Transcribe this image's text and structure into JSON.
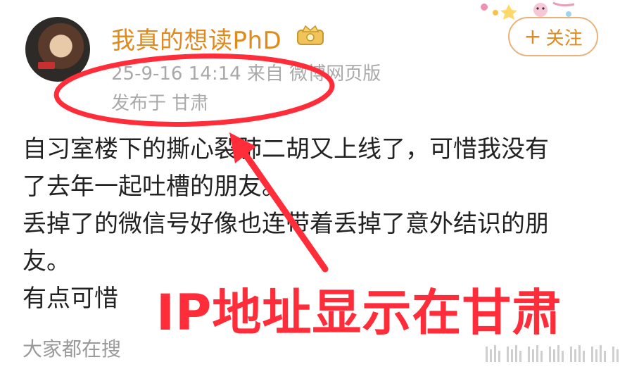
{
  "post": {
    "username": "我真的想读PhD",
    "meta": "25-9-16 14:14  来自 微博网页版",
    "location": "发布于 甘肃",
    "follow_label": "关注",
    "body_lines": [
      "自习室楼下的撕心裂肺二胡又上线了，可惜我没有",
      "了去年一起吐槽的朋友。",
      "丢掉了的微信号好像也连带着丢掉了意外结识的朋",
      "友。",
      "有点可惜"
    ],
    "search_label": "大家都在搜"
  },
  "annotation": {
    "overlay_text": "IP地址显示在甘肃",
    "color": "#ff2d3a"
  },
  "colors": {
    "username": "#e08a1e",
    "meta": "#a9a9a9",
    "follow_border": "#e9b27a"
  },
  "icons": {
    "badge": "crown-badge-icon",
    "follow_plus": "plus-icon"
  }
}
